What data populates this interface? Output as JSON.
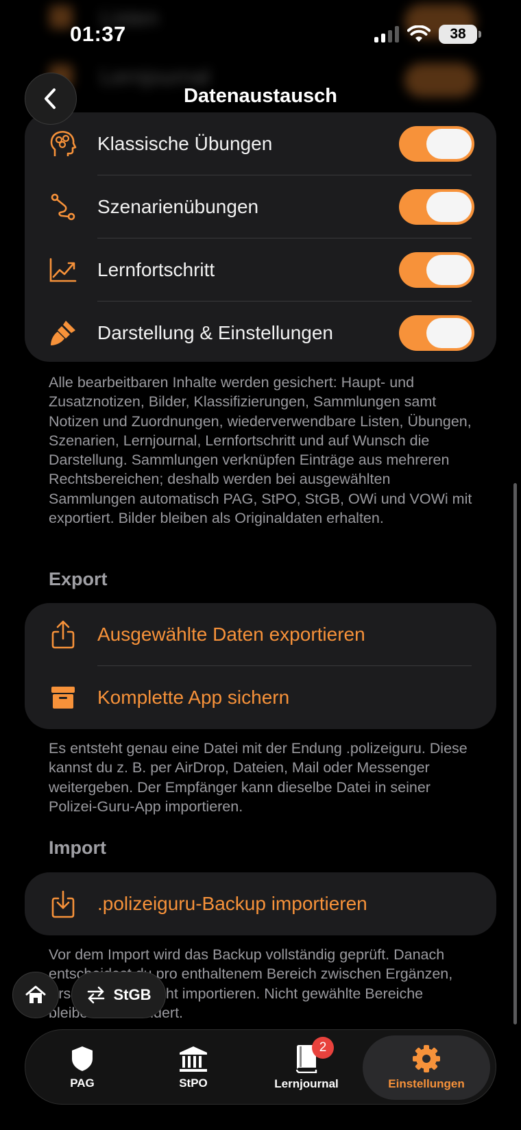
{
  "status": {
    "time": "01:37",
    "battery": "38"
  },
  "ghost_rows": [
    {
      "label": "Listen"
    },
    {
      "label": "Lernjournal"
    }
  ],
  "header": {
    "title": "Datenaustausch"
  },
  "content_toggles": [
    {
      "label": "Klassische Übungen",
      "icon": "brain-head-icon",
      "on": true
    },
    {
      "label": "Szenarienübungen",
      "icon": "route-icon",
      "on": true
    },
    {
      "label": "Lernfortschritt",
      "icon": "chart-up-icon",
      "on": true
    },
    {
      "label": "Darstellung & Einstellungen",
      "icon": "paintbrush-icon",
      "on": true
    }
  ],
  "backup_note": "Alle bearbeitbaren Inhalte werden gesichert: Haupt- und Zusatznotizen, Bilder, Klassifizierungen, Sammlungen samt Notizen und Zuordnungen, wiederverwendbare Listen, Übungen, Szenarien, Lernjournal, Lernfortschritt und auf Wunsch die Darstellung. Sammlungen verknüpfen Einträge aus mehreren Rechtsbereichen; deshalb werden bei ausgewählten Sammlungen automatisch PAG, StPO, StGB, OWi und VOWi mit exportiert. Bilder bleiben als Originaldaten erhalten.",
  "export": {
    "header": "Export",
    "items": [
      {
        "label": "Ausgewählte Daten exportieren",
        "icon": "share-icon"
      },
      {
        "label": "Komplette App sichern",
        "icon": "archive-box-icon"
      }
    ],
    "note": "Es entsteht genau eine Datei mit der Endung .polizeiguru. Diese kannst du z. B. per AirDrop, Dateien, Mail oder Messenger weitergeben. Der Empfänger kann dieselbe Datei in seiner Polizei-Guru-App importieren."
  },
  "import": {
    "header": "Import",
    "item": {
      "label": ".polizeiguru-Backup importieren",
      "icon": "download-tray-icon"
    },
    "note": "Vor dem Import wird das Backup vollständig geprüft. Danach entscheidest du pro enthaltenem Bereich zwischen Ergänzen, Ersetzen oder Nicht importieren. Nicht gewählte Bereiche bleiben unverändert."
  },
  "floating": {
    "law_chip": "StGB"
  },
  "tabs": [
    {
      "label": "PAG",
      "icon": "shield-icon"
    },
    {
      "label": "StPO",
      "icon": "courthouse-icon"
    },
    {
      "label": "Lernjournal",
      "icon": "book-icon",
      "badge": "2"
    },
    {
      "label": "Einstellungen",
      "icon": "gear-icon",
      "active": true
    }
  ],
  "colors": {
    "accent": "#f7923a",
    "card": "#1c1c1e",
    "background": "#000000",
    "badge": "#e8423d"
  }
}
